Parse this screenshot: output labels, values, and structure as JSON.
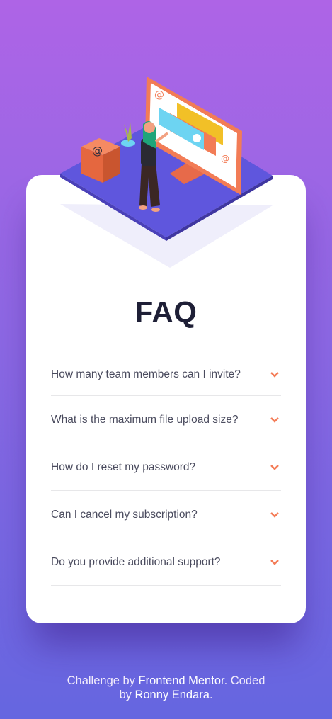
{
  "faq": {
    "title": "FAQ",
    "items": [
      {
        "question": "How many team members can I invite?",
        "icon": "chevron-down-icon"
      },
      {
        "question": "What is the maximum file upload size?",
        "icon": "chevron-down-icon"
      },
      {
        "question": "How do I reset my password?",
        "icon": "chevron-down-icon"
      },
      {
        "question": "Can I cancel my subscription?",
        "icon": "chevron-down-icon"
      },
      {
        "question": "Do you provide additional support?",
        "icon": "chevron-down-icon"
      }
    ]
  },
  "footer": {
    "line1_prefix": "Challenge by ",
    "line1_link": "Frontend Mentor",
    "line1_suffix": ". Coded",
    "line2_prefix": "by ",
    "line2_link": "Ronny Endara",
    "line2_suffix": "."
  },
  "colors": {
    "accent": "#f47c57",
    "heading": "#1e1f36",
    "text": "#4a4b5e",
    "bg_top": "#ae64e6",
    "bg_bottom": "#6566e0"
  }
}
